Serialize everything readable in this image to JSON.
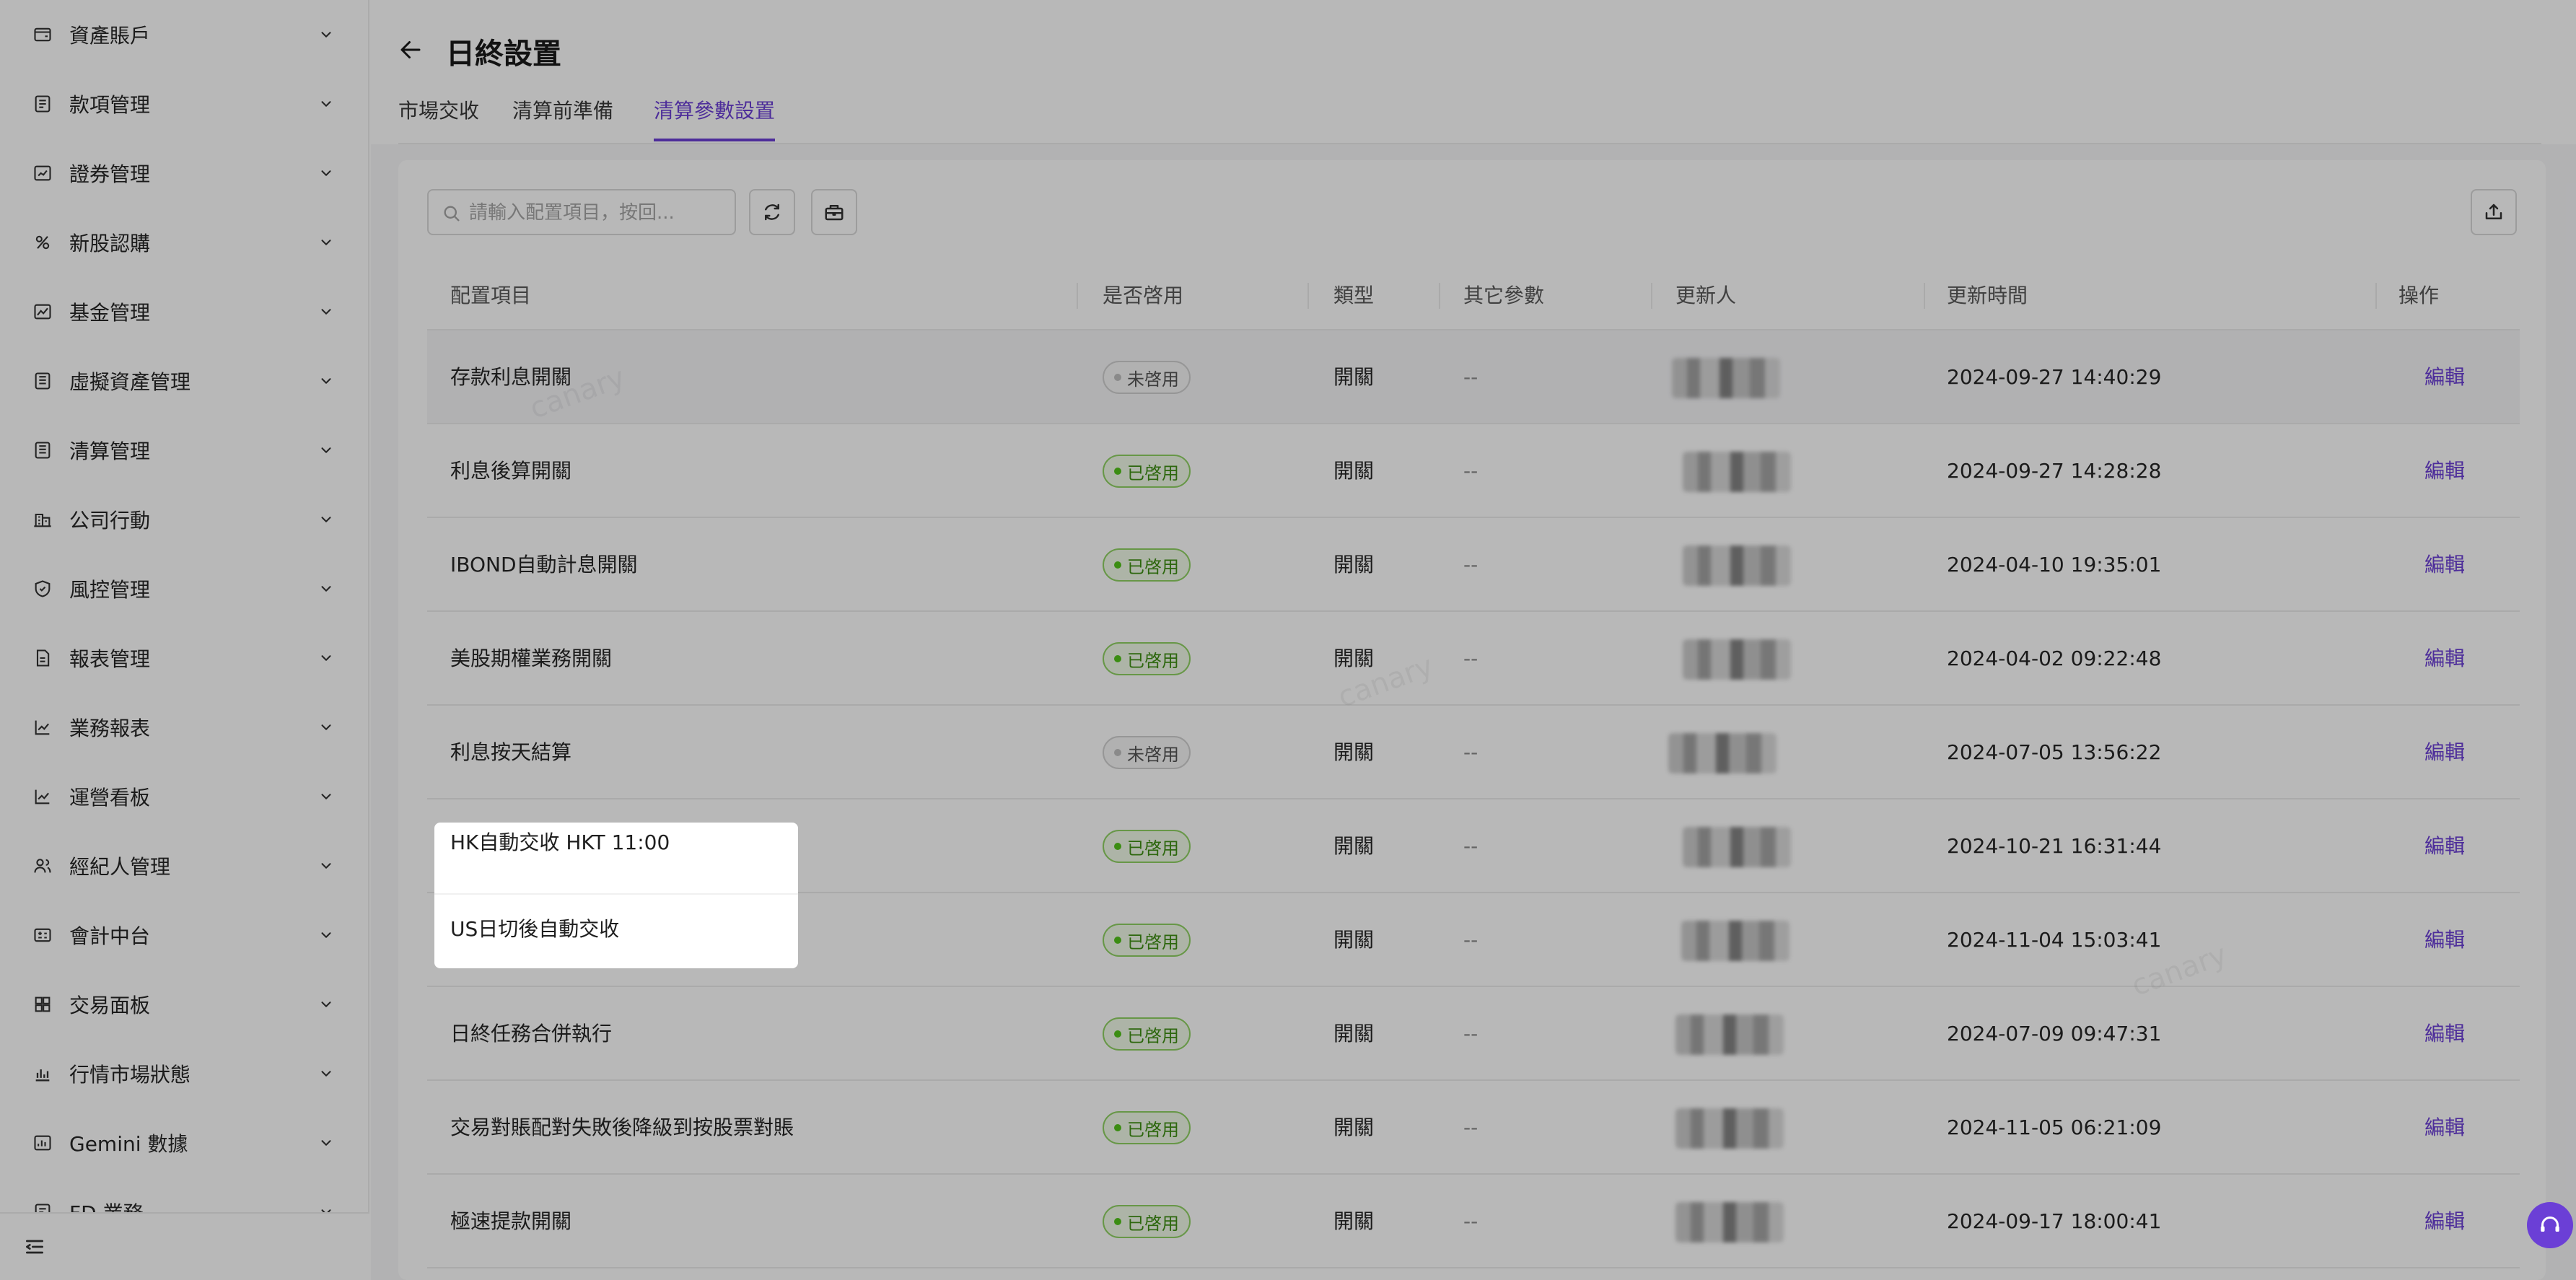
{
  "sidebar": {
    "items": [
      {
        "label": "資產賬戶",
        "icon": "wallet-icon"
      },
      {
        "label": "款項管理",
        "icon": "receipt-icon"
      },
      {
        "label": "證券管理",
        "icon": "chart-box-icon"
      },
      {
        "label": "新股認購",
        "icon": "ipo-icon"
      },
      {
        "label": "基金管理",
        "icon": "fund-icon"
      },
      {
        "label": "虛擬資產管理",
        "icon": "ledger-icon"
      },
      {
        "label": "清算管理",
        "icon": "ledger-icon"
      },
      {
        "label": "公司行動",
        "icon": "building-icon"
      },
      {
        "label": "風控管理",
        "icon": "shield-icon"
      },
      {
        "label": "報表管理",
        "icon": "report-icon"
      },
      {
        "label": "業務報表",
        "icon": "line-chart-icon"
      },
      {
        "label": "運營看板",
        "icon": "line-chart-icon"
      },
      {
        "label": "經紀人管理",
        "icon": "user-group-icon"
      },
      {
        "label": "會計中台",
        "icon": "accounting-icon"
      },
      {
        "label": "交易面板",
        "icon": "grid-icon"
      },
      {
        "label": "行情市場狀態",
        "icon": "bar-chart-icon"
      },
      {
        "label": "Gemini 數據",
        "icon": "data-icon"
      },
      {
        "label": "FD 業務",
        "icon": "fd-icon"
      }
    ]
  },
  "header": {
    "title": "日終設置",
    "tabs": [
      {
        "label": "市場交收"
      },
      {
        "label": "清算前準備"
      },
      {
        "label": "清算參數設置"
      }
    ]
  },
  "toolbar": {
    "search_placeholder": "請輸入配置項目，按回..."
  },
  "table": {
    "columns": [
      "配置項目",
      "是否啓用",
      "類型",
      "其它參數",
      "更新人",
      "更新時間",
      "操作"
    ],
    "rows": [
      {
        "item": "存款利息開關",
        "status": "未啓用",
        "enabled": false,
        "type": "開關",
        "params": "--",
        "time": "2024-09-27 14:40:29",
        "action": "編輯"
      },
      {
        "item": "利息後算開關",
        "status": "已啓用",
        "enabled": true,
        "type": "開關",
        "params": "--",
        "time": "2024-09-27 14:28:28",
        "action": "編輯"
      },
      {
        "item": "IBOND自動計息開關",
        "status": "已啓用",
        "enabled": true,
        "type": "開關",
        "params": "--",
        "time": "2024-04-10 19:35:01",
        "action": "編輯"
      },
      {
        "item": "美股期權業務開關",
        "status": "已啓用",
        "enabled": true,
        "type": "開關",
        "params": "--",
        "time": "2024-04-02 09:22:48",
        "action": "編輯"
      },
      {
        "item": "利息按天結算",
        "status": "未啓用",
        "enabled": false,
        "type": "開關",
        "params": "--",
        "time": "2024-07-05 13:56:22",
        "action": "編輯"
      },
      {
        "item": "HK自動交收 HKT 11:00",
        "status": "已啓用",
        "enabled": true,
        "type": "開關",
        "params": "--",
        "time": "2024-10-21 16:31:44",
        "action": "編輯"
      },
      {
        "item": "US日切後自動交收",
        "status": "已啓用",
        "enabled": true,
        "type": "開關",
        "params": "--",
        "time": "2024-11-04 15:03:41",
        "action": "編輯"
      },
      {
        "item": "日終任務合併執行",
        "status": "已啓用",
        "enabled": true,
        "type": "開關",
        "params": "--",
        "time": "2024-07-09 09:47:31",
        "action": "編輯"
      },
      {
        "item": "交易對賬配對失敗後降級到按股票對賬",
        "status": "已啓用",
        "enabled": true,
        "type": "開關",
        "params": "--",
        "time": "2024-11-05 06:21:09",
        "action": "編輯"
      },
      {
        "item": "極速提款開關",
        "status": "已啓用",
        "enabled": true,
        "type": "開關",
        "params": "--",
        "time": "2024-09-17 18:00:41",
        "action": "編輯"
      }
    ]
  },
  "popup": {
    "items": [
      "HK自動交收 HKT 11:00",
      "US日切後自動交收"
    ]
  },
  "colors": {
    "accent": "#6b3fd6",
    "enabled": "#52c41a",
    "disabled": "#bfbfbf"
  }
}
